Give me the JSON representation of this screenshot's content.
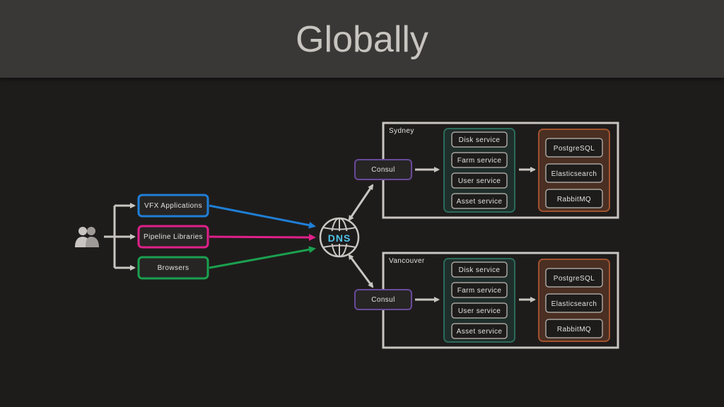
{
  "title": "Globally",
  "colors": {
    "background": "#1e1c1b",
    "title_bar": "#3a3837",
    "vfx": "#1f7fd6",
    "pipeline": "#e0208a",
    "browsers": "#1aa04f",
    "consul": "#6a4a9a",
    "services": "#2a6b5a",
    "datastores": "#a0522d",
    "dns_text": "#4fc3e8"
  },
  "users_icon": "users-icon",
  "dns_icon": "globe-icon",
  "clients": [
    {
      "label": "VFX Applications"
    },
    {
      "label": "Pipeline Libraries"
    },
    {
      "label": "Browsers"
    }
  ],
  "dns": {
    "label": "DNS"
  },
  "regions": [
    {
      "name": "Sydney",
      "consul": "Consul",
      "services": [
        "Disk service",
        "Farm service",
        "User service",
        "Asset service"
      ],
      "datastores": [
        "PostgreSQL",
        "Elasticsearch",
        "RabbitMQ"
      ]
    },
    {
      "name": "Vancouver",
      "consul": "Consul",
      "services": [
        "Disk service",
        "Farm service",
        "User service",
        "Asset service"
      ],
      "datastores": [
        "PostgreSQL",
        "Elasticsearch",
        "RabbitMQ"
      ]
    }
  ]
}
